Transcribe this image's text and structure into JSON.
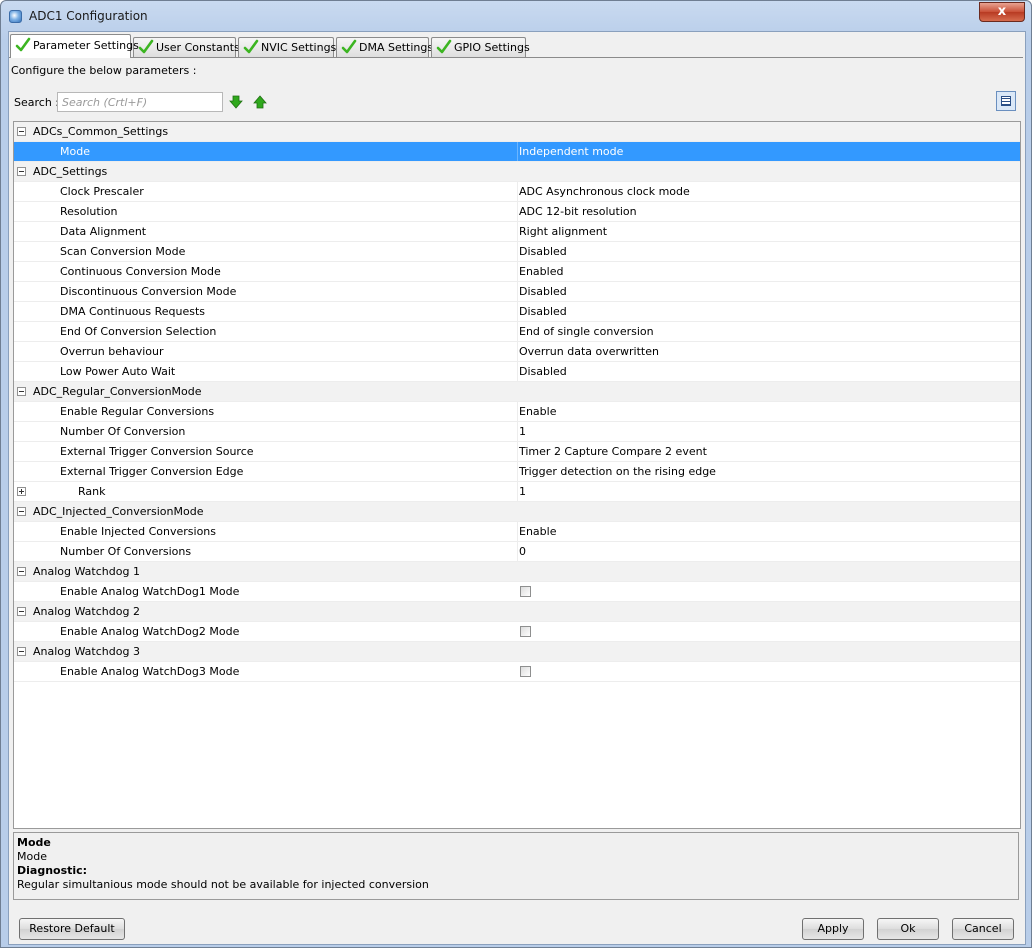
{
  "window": {
    "title": "ADC1 Configuration",
    "close_label": "x"
  },
  "tabs": [
    {
      "label": "Parameter Settings",
      "active": true
    },
    {
      "label": "User Constants",
      "active": false
    },
    {
      "label": "NVIC Settings",
      "active": false
    },
    {
      "label": "DMA Settings",
      "active": false
    },
    {
      "label": "GPIO Settings",
      "active": false
    }
  ],
  "panel": {
    "instruction": "Configure the below parameters :",
    "search_label": "Search :",
    "search_placeholder": "Search (Crtl+F)",
    "search_value": ""
  },
  "parameters": {
    "group_common": "ADCs_Common_Settings",
    "mode_label": "Mode",
    "mode_value": "Independent mode",
    "group_adc": "ADC_Settings",
    "clock_prescaler_label": "Clock Prescaler",
    "clock_prescaler_value": "ADC Asynchronous clock mode",
    "resolution_label": "Resolution",
    "resolution_value": "ADC 12-bit resolution",
    "data_alignment_label": "Data Alignment",
    "data_alignment_value": "Right alignment",
    "scan_mode_label": "Scan Conversion Mode",
    "scan_mode_value": "Disabled",
    "continuous_mode_label": "Continuous Conversion Mode",
    "continuous_mode_value": "Enabled",
    "discontinuous_mode_label": "Discontinuous Conversion Mode",
    "discontinuous_mode_value": "Disabled",
    "dma_requests_label": "DMA Continuous Requests",
    "dma_requests_value": "Disabled",
    "eoc_selection_label": "End Of Conversion Selection",
    "eoc_selection_value": "End of single conversion",
    "overrun_label": "Overrun behaviour",
    "overrun_value": "Overrun data overwritten",
    "low_power_label": "Low Power Auto Wait",
    "low_power_value": "Disabled",
    "group_regular": "ADC_Regular_ConversionMode",
    "enable_regular_label": "Enable Regular Conversions",
    "enable_regular_value": "Enable",
    "number_of_conversion_label": "Number Of Conversion",
    "number_of_conversion_value": "1",
    "ext_trigger_source_label": "External Trigger Conversion Source",
    "ext_trigger_source_value": "Timer 2 Capture Compare 2 event",
    "ext_trigger_edge_label": "External Trigger Conversion Edge",
    "ext_trigger_edge_value": "Trigger detection on the rising edge",
    "rank_label": "Rank",
    "rank_value": "1",
    "group_injected": "ADC_Injected_ConversionMode",
    "enable_injected_label": "Enable Injected Conversions",
    "enable_injected_value": "Enable",
    "number_of_conversions_label": "Number Of Conversions",
    "number_of_conversions_value": "0",
    "group_watchdog1": "Analog Watchdog 1",
    "watchdog1_label": "Enable Analog WatchDog1 Mode",
    "watchdog1_checked": false,
    "group_watchdog2": "Analog Watchdog 2",
    "watchdog2_label": "Enable Analog WatchDog2 Mode",
    "watchdog2_checked": false,
    "group_watchdog3": "Analog Watchdog 3",
    "watchdog3_label": "Enable Analog WatchDog3 Mode",
    "watchdog3_checked": false
  },
  "description": {
    "title": "Mode",
    "text": "Mode",
    "diagnostic_title": "Diagnostic:",
    "diagnostic_text": "Regular simultanious mode should not be available for injected conversion"
  },
  "buttons": {
    "restore_default": "Restore Default",
    "apply": "Apply",
    "ok": "Ok",
    "cancel": "Cancel"
  },
  "colors": {
    "selection": "#3399ff",
    "check_green": "#3cb521",
    "arrow_green": "#2fa81c"
  },
  "icons": {
    "tab_check": "checkmark-icon",
    "search_next": "arrow-down-icon",
    "search_prev": "arrow-up-icon",
    "view_toggle": "list-view-icon",
    "expand": "tree-collapse-icon"
  }
}
